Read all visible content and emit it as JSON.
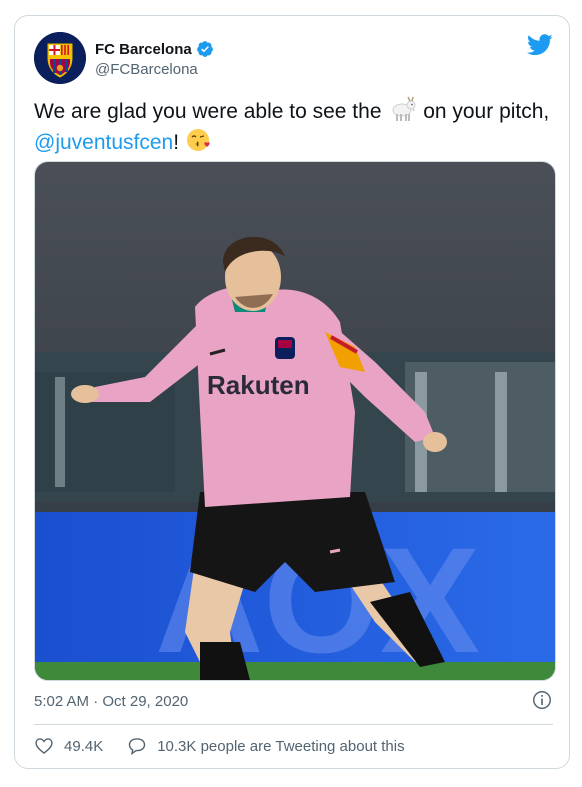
{
  "tweet": {
    "author_name": "FC Barcelona",
    "author_handle": "@FCBarcelona",
    "text_before": "We are glad you were able to see the",
    "text_middle": "on your pitch,",
    "mention": "@juventusfcen",
    "text_after": "!",
    "timestamp": "5:02 AM · Oct 29, 2020",
    "likes": "49.4K",
    "tweeting_about": "10.3K people are Tweeting about this"
  },
  "photo": {
    "jersey_sponsor": "Rakuten",
    "ad_board_text": "AOX"
  },
  "icons": {
    "verified": "verified-badge-icon",
    "bird": "twitter-bird-icon",
    "goat": "goat-emoji-icon",
    "kiss": "face-blowing-kiss-emoji-icon",
    "info": "info-icon",
    "like": "heart-icon",
    "reply": "speech-bubble-icon"
  },
  "colors": {
    "twitter_blue": "#1d9bf0",
    "text_primary": "#0f1419",
    "text_secondary": "#536471",
    "border": "#cfd9de",
    "jersey_pink": "#e9a3c4"
  }
}
